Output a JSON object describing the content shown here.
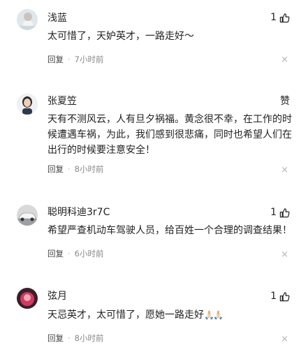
{
  "comments": [
    {
      "username": "浅蓝",
      "like_count": "1",
      "text": "太可惜了，天妒英才，一路走好～",
      "reply_label": "回复",
      "separator": "·",
      "time": "7小时前",
      "close_glyph": "×"
    },
    {
      "username": "张夏笠",
      "like_label": "赞",
      "text": "天有不测风云，人有旦夕祸福。黄念很不幸，在工作的时候遭遇车祸，为此，我们感到很悲痛，同时也希望人们在出行的时候要注意安全！",
      "reply_label": "回复",
      "separator": "·",
      "time": "8小时前",
      "close_glyph": "×"
    },
    {
      "username": "聪明科迪3r7C",
      "like_count": "1",
      "text": "希望严查机动车驾驶人员，给百姓一个合理的调查结果！",
      "reply_label": "回复",
      "separator": "·",
      "time": "6小时前",
      "close_glyph": "×"
    },
    {
      "username": "弦月",
      "like_count": "1",
      "text": "天忌英才，太可惜了，愿她一路走好",
      "text_emoji": "🙏🏻🙏🏻",
      "reply_label": "回复",
      "separator": "·",
      "time": "8小时前",
      "close_glyph": "×"
    }
  ],
  "icons": {
    "like": "thumbs-up-icon",
    "close": "close-icon"
  }
}
